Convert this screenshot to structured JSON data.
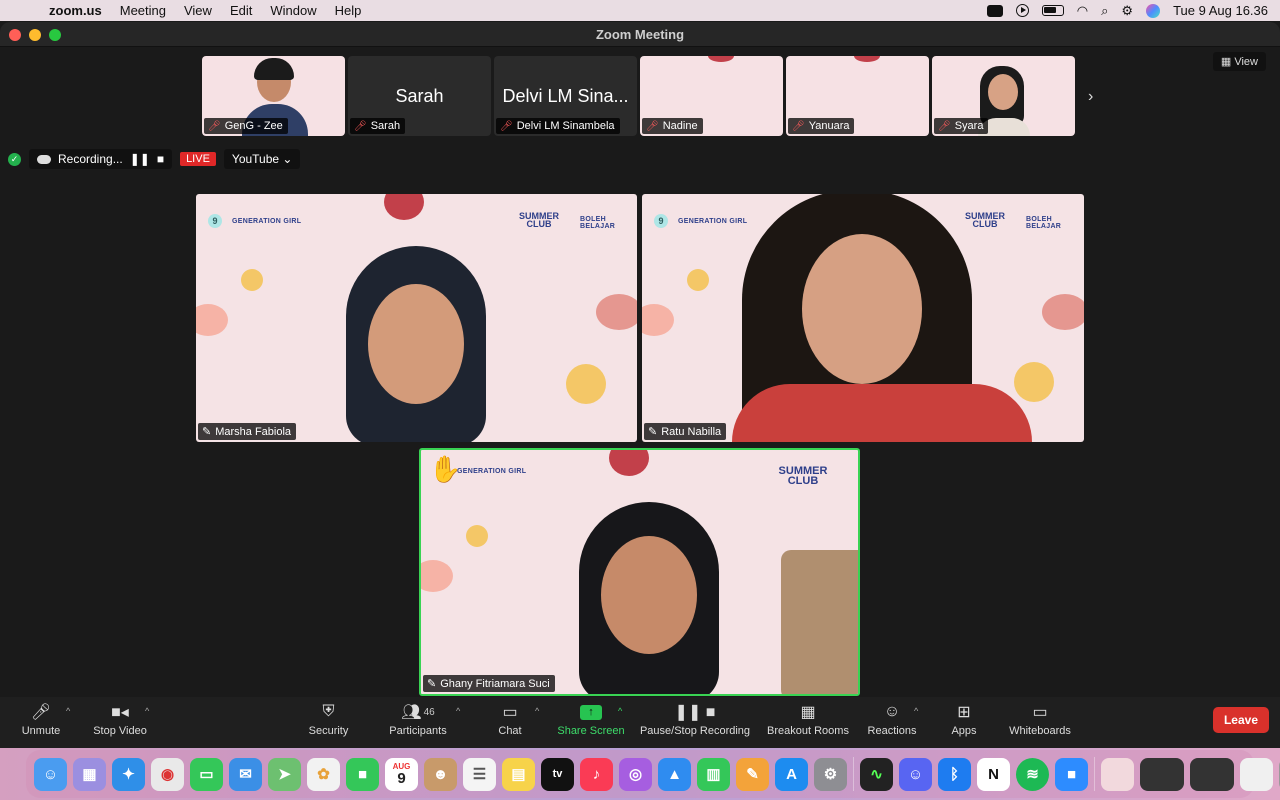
{
  "menubar": {
    "app": "zoom.us",
    "items": [
      "Meeting",
      "View",
      "Edit",
      "Window",
      "Help"
    ],
    "clock": "Tue 9 Aug  16.36"
  },
  "window": {
    "title": "Zoom Meeting"
  },
  "strip": {
    "view_label": "View",
    "thumbs": [
      {
        "name": "GenG - Zee",
        "big": ""
      },
      {
        "name": "Sarah",
        "big": "Sarah"
      },
      {
        "name": "Delvi LM Sinambela",
        "big": "Delvi LM Sina..."
      },
      {
        "name": "Nadine",
        "big": ""
      },
      {
        "name": "Yanuara",
        "big": ""
      },
      {
        "name": "Syara",
        "big": ""
      }
    ]
  },
  "recording": {
    "label": "Recording...",
    "live": "LIVE",
    "platform": "YouTube"
  },
  "tiles": {
    "brand": "GENERATION GIRL",
    "summer": "SUMMER CLUB",
    "boleh": "BOLEH BELAJAR",
    "marsha": "Marsha Fabiola",
    "ratu": "Ratu Nabilla",
    "ghany": "Ghany Fitriamara Suci"
  },
  "toolbar": {
    "unmute": "Unmute",
    "stop_video": "Stop Video",
    "security": "Security",
    "participants": "Participants",
    "participant_count": "46",
    "chat": "Chat",
    "share_screen": "Share Screen",
    "pause_stop": "Pause/Stop Recording",
    "breakout": "Breakout Rooms",
    "reactions": "Reactions",
    "apps": "Apps",
    "whiteboards": "Whiteboards",
    "leave": "Leave"
  },
  "dock": {
    "calendar_month": "AUG",
    "calendar_day": "9",
    "tv_label": "tv"
  }
}
